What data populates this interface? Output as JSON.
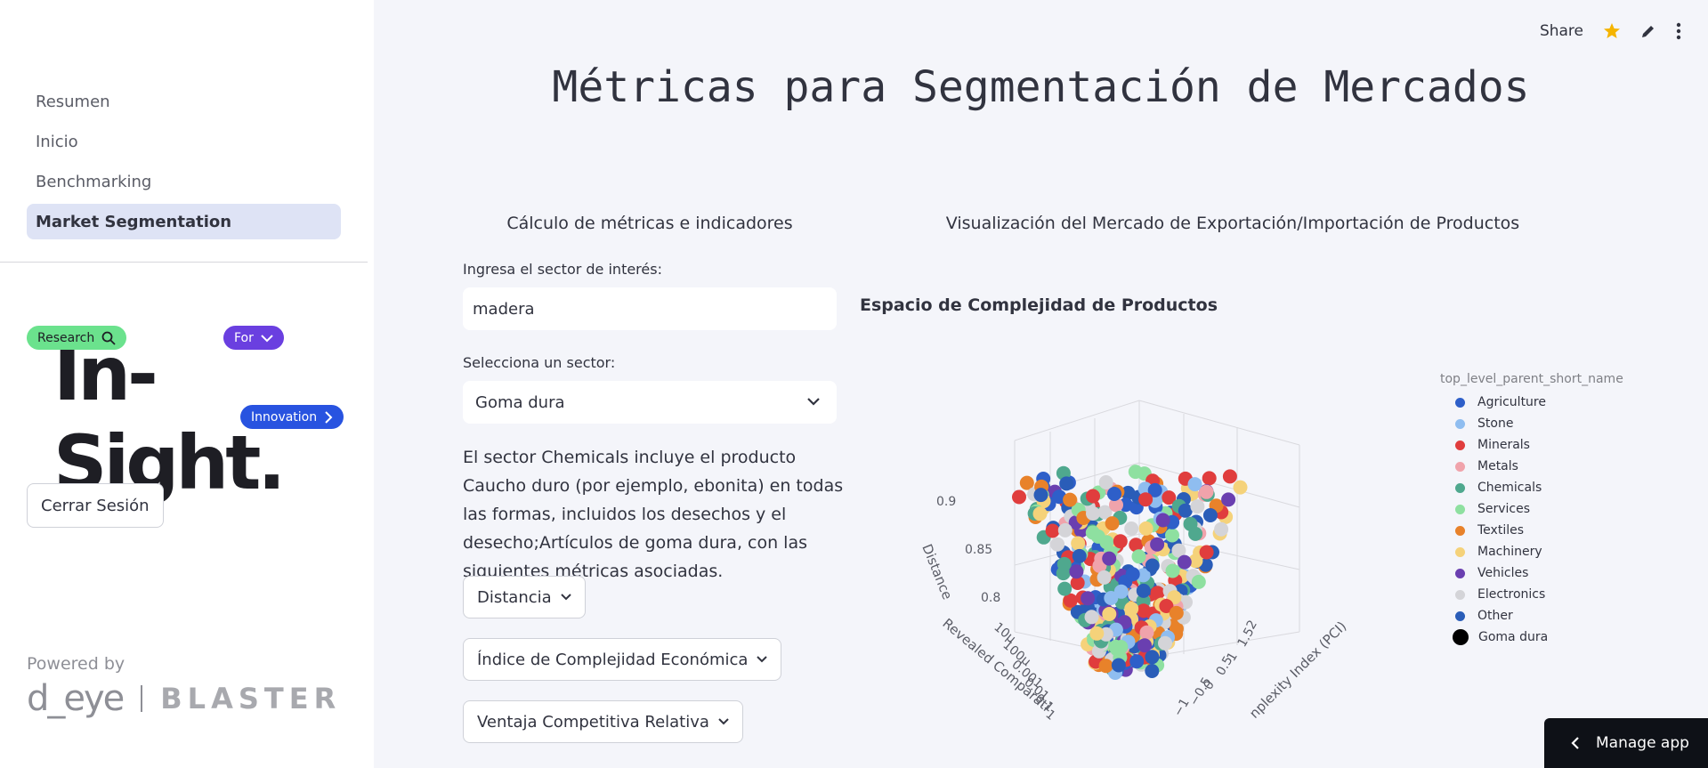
{
  "sidebar": {
    "nav": [
      "Resumen",
      "Inicio",
      "Benchmarking",
      "Market Segmentation"
    ],
    "active": "Market Segmentation",
    "logo": {
      "word": "In-Sight.",
      "research": "Research",
      "for": "For",
      "innovation": "Innovation"
    },
    "logout": "Cerrar Sesión",
    "powered_by": "Powered by",
    "brand_left": "d_eye",
    "brand_right": "BLASTER"
  },
  "topbar": {
    "share": "Share"
  },
  "page_title": "Métricas para Segmentación de Mercados",
  "left": {
    "header": "Cálculo de métricas e indicadores",
    "search_label": "Ingresa el sector de interés:",
    "search_value": "madera",
    "select_label": "Selecciona un sector:",
    "select_value": "Goma dura",
    "description": "El sector Chemicals incluye el producto Caucho duro (por ejemplo, ebonita) en todas las formas, incluidos los desechos y el desecho;Artículos de goma dura, con las siguientes métricas asociadas.",
    "expanders": [
      "Distancia",
      "Índice de Complejidad Económica",
      "Ventaja Competitiva Relativa"
    ]
  },
  "right": {
    "header": "Visualización del Mercado de Exportación/Importación de Productos",
    "plot_title": "Espacio de Complejidad de Productos",
    "legend_title": "top_level_parent_short_name",
    "legend": [
      {
        "name": "Agriculture",
        "color": "#2e5fc9"
      },
      {
        "name": "Stone",
        "color": "#8fbdf0"
      },
      {
        "name": "Minerals",
        "color": "#e03d3d"
      },
      {
        "name": "Metals",
        "color": "#f0a3ab"
      },
      {
        "name": "Chemicals",
        "color": "#4fa88e"
      },
      {
        "name": "Services",
        "color": "#8ee0a0"
      },
      {
        "name": "Textiles",
        "color": "#e8822a"
      },
      {
        "name": "Machinery",
        "color": "#f5d27a"
      },
      {
        "name": "Vehicles",
        "color": "#6a3fb0"
      },
      {
        "name": "Electronics",
        "color": "#d4d4d8"
      },
      {
        "name": "Other",
        "color": "#2a5db8"
      },
      {
        "name": "Goma dura",
        "color": "#000000"
      }
    ],
    "axes": {
      "z_label": "Distance",
      "z_ticks": [
        "0.9",
        "0.85",
        "0.8"
      ],
      "x_label": "Revealed Comparati",
      "x_ticks": [
        "10μ",
        "100μ",
        "0.001",
        "0.01",
        "0.1",
        "1"
      ],
      "y_label": "nplexity Index (PCI)",
      "y_ticks": [
        "2",
        "1.5",
        "1",
        "0.5",
        "0",
        "−0.5",
        "−1"
      ]
    }
  },
  "manage": {
    "label": "Manage app"
  }
}
